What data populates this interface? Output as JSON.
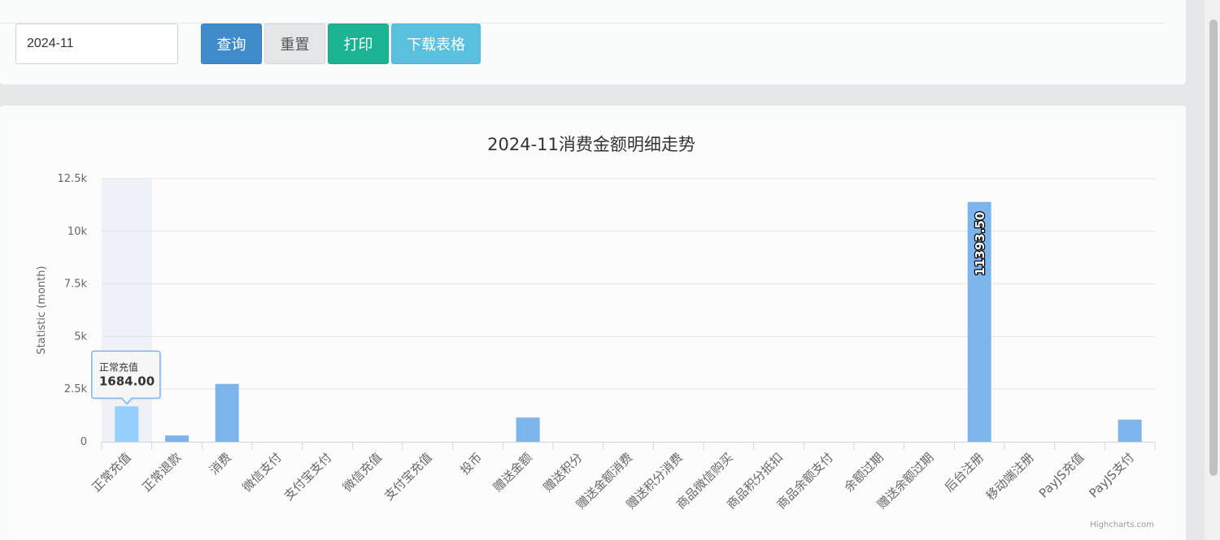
{
  "filter": {
    "date_value": "2024-11",
    "query_label": "查询",
    "reset_label": "重置",
    "print_label": "打印",
    "download_label": "下载表格"
  },
  "chart_data": {
    "type": "bar",
    "title": "2024-11消费金额明细走势",
    "ylabel": "Statistic (month)",
    "xlabel": "",
    "ylim": [
      0,
      12500
    ],
    "yticks": [
      0,
      2500,
      5000,
      7500,
      10000,
      12500
    ],
    "ytick_labels": [
      "0",
      "2.5k",
      "5k",
      "7.5k",
      "10k",
      "12.5k"
    ],
    "categories": [
      "正常充值",
      "正常退款",
      "消费",
      "微信支付",
      "支付宝支付",
      "微信充值",
      "支付宝充值",
      "投币",
      "赠送金额",
      "赠送积分",
      "赠送金额消费",
      "赠送积分消费",
      "商品微信购买",
      "商品积分抵扣",
      "商品余额支付",
      "余额过期",
      "赠送余额过期",
      "后台注册",
      "移动端注册",
      "PayJS充值",
      "PayJS支付"
    ],
    "values": [
      1684,
      300,
      2750,
      0,
      0,
      0,
      0,
      0,
      1150,
      0,
      0,
      0,
      0,
      0,
      0,
      0,
      0,
      11393.5,
      0,
      0,
      1050
    ],
    "data_labels": [
      {
        "index": 17,
        "text": "11393.50"
      }
    ],
    "tooltip": {
      "index": 0,
      "category": "正常充值",
      "value": "1684.00"
    },
    "highlight_index": 0,
    "grid": true,
    "legend": false,
    "series_color": "#7cb5ec",
    "hover_color": "#95ceff",
    "credits": "Highcharts.com"
  }
}
